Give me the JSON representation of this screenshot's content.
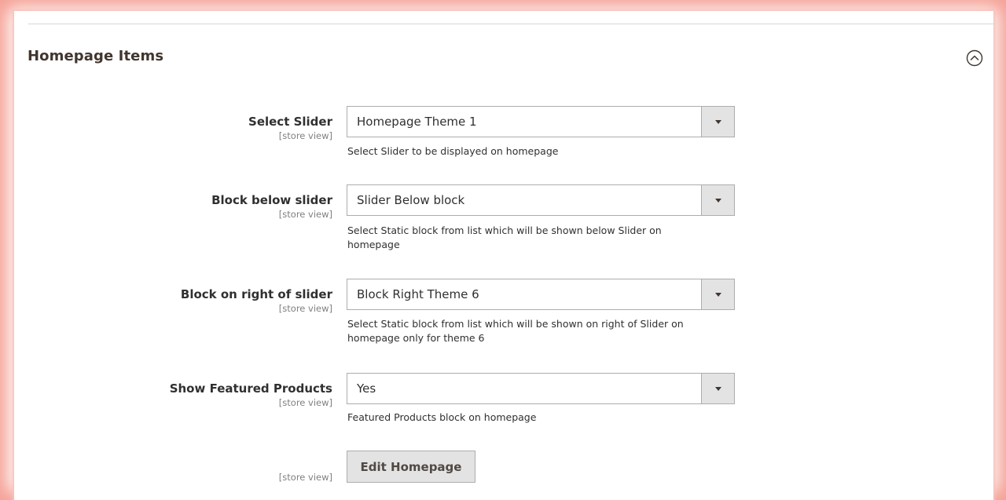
{
  "section": {
    "title": "Homepage Items",
    "collapse_icon": "chevron-up-circle-icon"
  },
  "fields": [
    {
      "label": "Select Slider",
      "scope": "[store view]",
      "value": "Homepage Theme 1",
      "note": "Select Slider to be displayed on homepage"
    },
    {
      "label": "Block below slider",
      "scope": "[store view]",
      "value": "Slider Below block",
      "note": "Select Static block from list which will be shown below Slider on homepage"
    },
    {
      "label": "Block on right of slider",
      "scope": "[store view]",
      "value": "Block Right Theme 6",
      "note": "Select Static block from list which will be shown on right of Slider on homepage only for theme 6"
    },
    {
      "label": "Show Featured Products",
      "scope": "[store view]",
      "value": "Yes",
      "note": "Featured Products block on homepage"
    }
  ],
  "edit_row": {
    "scope": "[store view]",
    "button_label": "Edit Homepage"
  },
  "colors": {
    "frame_glow": "#f5a095",
    "select_arrow_bg": "#e3e3e3",
    "button_bg": "#e3e3e3",
    "title_text": "#41362f"
  }
}
